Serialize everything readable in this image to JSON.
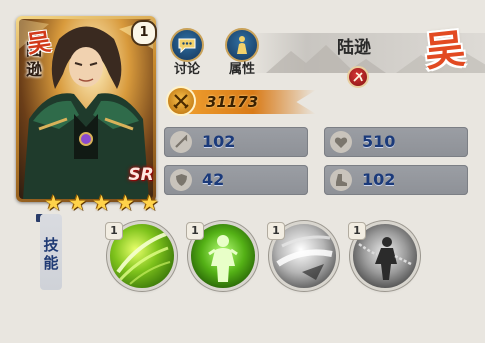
{
  "hero": {
    "name": "陆逊",
    "card_name": "陆\n逊",
    "level": "1",
    "faction_glyph": "吴",
    "rarity": "SR",
    "stars": 5,
    "power": "31173"
  },
  "actions": {
    "discuss": "讨论",
    "attributes": "属性"
  },
  "stats": {
    "attack": "102",
    "hp": "510",
    "defense": "42",
    "speed": "102"
  },
  "skills": {
    "label": "技能",
    "items": [
      {
        "level": "1",
        "name": "wind-slash-icon",
        "state": "active"
      },
      {
        "level": "1",
        "name": "green-aura-figure-icon",
        "state": "active"
      },
      {
        "level": "1",
        "name": "gray-slash-icon",
        "state": "locked"
      },
      {
        "level": "1",
        "name": "chained-warrior-icon",
        "state": "locked"
      }
    ]
  },
  "colors": {
    "faction": "#e24a22",
    "power_bar": "#e08a20",
    "stat_value": "#1b3a7a",
    "button_blue": "#1d4770"
  }
}
